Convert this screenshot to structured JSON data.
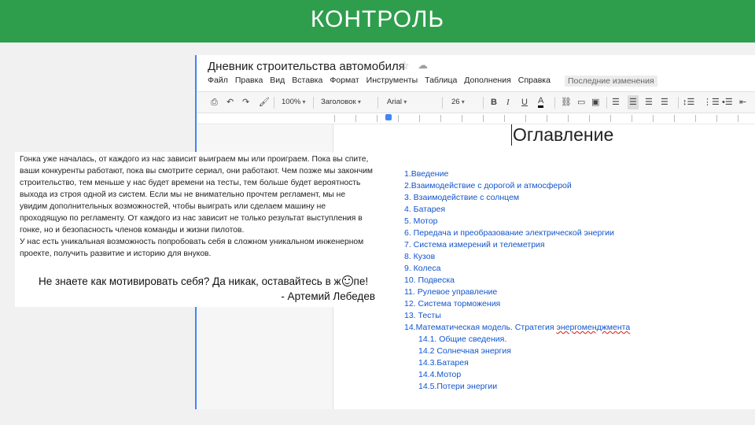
{
  "slide": {
    "title": "КОНТРОЛЬ"
  },
  "docs": {
    "title": "Дневник строительства автомобиля",
    "menu": [
      "Файл",
      "Правка",
      "Вид",
      "Вставка",
      "Формат",
      "Инструменты",
      "Таблица",
      "Дополнения",
      "Справка"
    ],
    "last_edit": "Последние изменения",
    "toolbar": {
      "zoom": "100%",
      "style": "Заголовок",
      "font": "Arial",
      "size": "26"
    },
    "icons": [
      "star-icon",
      "drive-icon",
      "print-icon",
      "undo-icon",
      "redo-icon",
      "paint-format-icon",
      "bold-icon",
      "italic-icon",
      "underline-icon",
      "text-color-icon",
      "link-icon",
      "comment-icon",
      "image-icon",
      "align-left-icon",
      "align-center-icon",
      "align-right-icon",
      "justify-icon",
      "line-spacing-icon",
      "numbered-list-icon",
      "bulleted-list-icon",
      "decrease-indent-icon",
      "increase-indent-icon"
    ]
  },
  "toc": {
    "heading": "Оглавление",
    "items": [
      "1.Введение",
      "2.Взаимодействие с дорогой и атмосферой",
      "3. Взаимодействие с солнцем",
      "4. Батарея",
      "5. Мотор",
      "6. Передача и преобразование электрической энергии",
      "7. Система измерений и телеметрия",
      "8. Кузов",
      "9. Колеса",
      "10. Подвеска",
      "11. Рулевое управление",
      "12. Система торможения",
      "13. Тесты"
    ],
    "item14_prefix": "14.Математическая модель. Стратегия ",
    "item14_word": "энергоменджмента",
    "subitems": [
      "14.1. Общие сведения.",
      "14.2 Солнечная энергия",
      "14.3.Батарея",
      "14.4.Мотор",
      "14.5.Потери энергии"
    ]
  },
  "quote": {
    "paragraph": "Гонка уже началась, от каждого из нас зависит выиграем мы или проиграем. Пока вы спите, ваши конкуренты работают, пока вы смотрите сериал, они работают. Чем позже мы закончим строительство, тем меньше у нас будет времени на тесты, тем больше будет вероятность выхода из строя одной из систем. Если мы не внимательно прочтем регламент, мы не увидим дополнительных возможностей, чтобы выиграть или сделаем машину не проходящую по регламенту. От каждого из нас зависит не только результат выступления в гонке, но и безопасность членов команды и жизни пилотов.",
    "paragraph2": "У нас есть уникальная возможность попробовать себя в сложном уникальном инженерном проекте, получить развитие и историю для внуков.",
    "line_before": "Не знаете как мотивировать себя? Да никак, оставайтесь в ж",
    "line_after": "пе!",
    "author": "- Артемий Лебедев"
  }
}
